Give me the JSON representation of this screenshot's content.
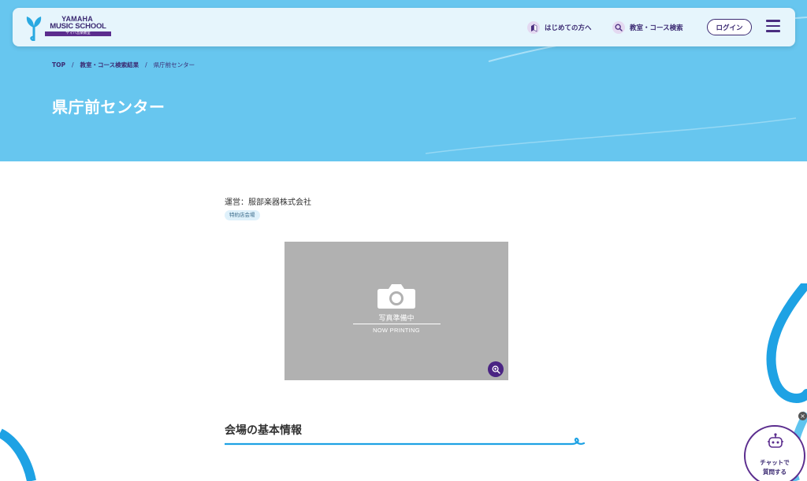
{
  "header": {
    "logo_line1": "YAMAHA",
    "logo_line2": "MUSIC SCHOOL",
    "logo_band": "ヤマハ音楽教室",
    "nav_beginner": "はじめての方へ",
    "nav_search": "教室・コース検索",
    "login": "ログイン",
    "icons": [
      "yamaha-logo",
      "beginner-mark-icon",
      "search-icon",
      "hamburger-menu-icon"
    ]
  },
  "breadcrumb": {
    "items": [
      "TOP",
      "教室・コース検索結果",
      "県庁前センター"
    ],
    "separator": "/"
  },
  "page": {
    "title": "県庁前センター"
  },
  "venue": {
    "operator": "運営：服部楽器株式会社",
    "tag": "特約店会場",
    "photo_label": "写真準備中",
    "photo_sub": "NOW PRINTING"
  },
  "section": {
    "heading": "会場の基本情報"
  },
  "chat": {
    "line1": "チャットで",
    "line2": "質問する",
    "close": "×"
  },
  "colors": {
    "hero_bg": "#67c6ef",
    "brand_purple": "#3b2a72",
    "accent_blue": "#1ea2e4"
  }
}
